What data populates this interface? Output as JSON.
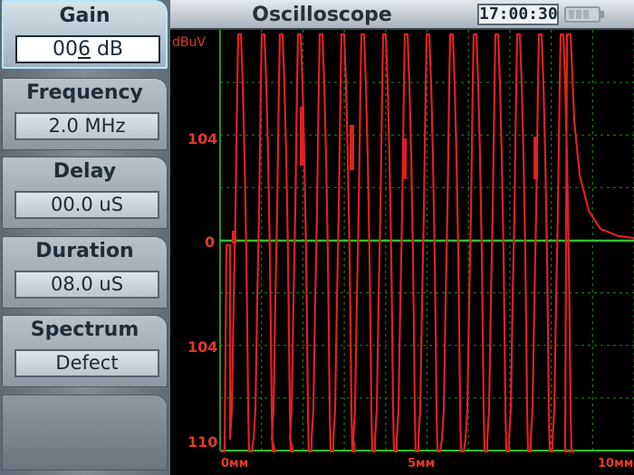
{
  "header": {
    "title": "Oscilloscope",
    "time": "17:00:30",
    "battery_icon": "battery-icon"
  },
  "controls": [
    {
      "label": "Gain",
      "value": "006 dB",
      "selected": true
    },
    {
      "label": "Frequency",
      "value": "2.0 MHz"
    },
    {
      "label": "Delay",
      "value": "00.0 uS"
    },
    {
      "label": "Duration",
      "value": "08.0 uS"
    },
    {
      "label": "Spectrum",
      "value": "Defect"
    }
  ],
  "chart_data": {
    "type": "line",
    "series": [
      {
        "values": []
      }
    ],
    "y_unit": "dBuV",
    "y_ticks": [
      "104",
      "0",
      "104",
      "110"
    ],
    "x_ticks": [
      "0мм",
      "5мм",
      "10мм"
    ],
    "x_range": [
      0,
      10
    ],
    "grid": true,
    "colors": {
      "trace": "#e02020",
      "grid": "#1f6e1f",
      "baseline": "#2fbf2f"
    }
  }
}
